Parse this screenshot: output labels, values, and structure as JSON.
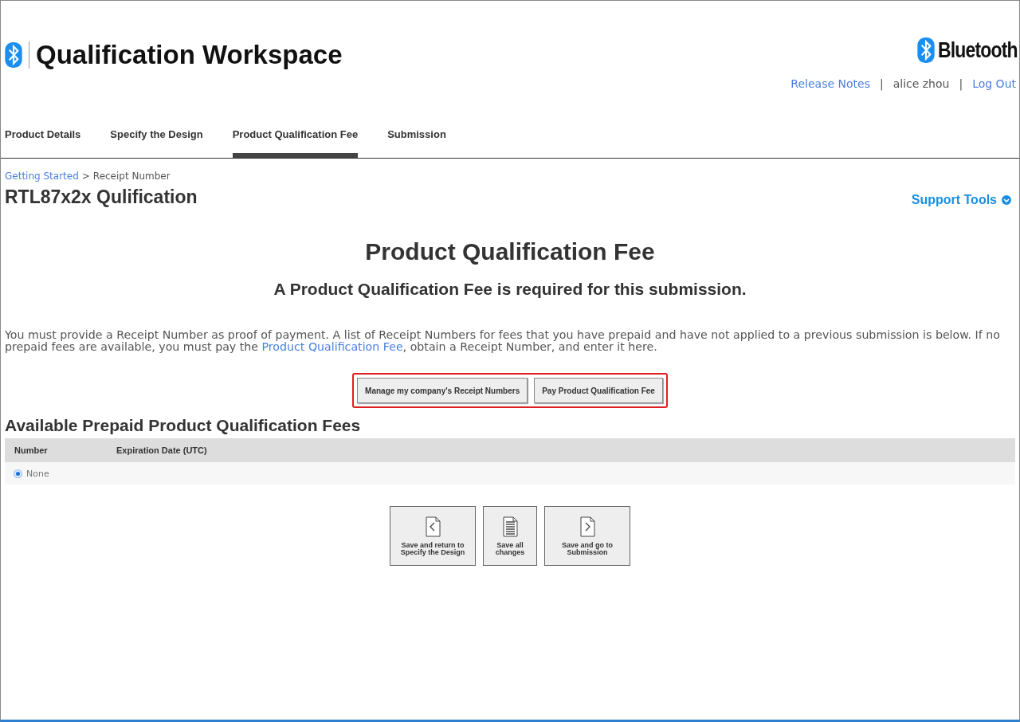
{
  "header": {
    "title": "Qualification Workspace",
    "brand": "Bluetooth",
    "links": [
      {
        "kind": "link",
        "label": "Release Notes"
      },
      {
        "kind": "separator",
        "label": "|"
      },
      {
        "kind": "text",
        "label": "alice zhou"
      },
      {
        "kind": "separator",
        "label": "|"
      },
      {
        "kind": "link",
        "label": "Log Out"
      }
    ]
  },
  "tabs": [
    {
      "label": "Product Details",
      "selected": false
    },
    {
      "label": "Specify the Design",
      "selected": false
    },
    {
      "label": "Product Qualification Fee",
      "selected": true
    },
    {
      "label": "Submission",
      "selected": false
    }
  ],
  "breadcrumb": {
    "link": "Getting Started",
    "separator": ">",
    "current": "Receipt Number"
  },
  "page_title": "RTL87x2x Qulification",
  "support_tools": "Support Tools",
  "heading": "Product Qualification Fee",
  "subheading": "A Product Qualification Fee is required for this submission.",
  "intro": {
    "before": "You must provide a Receipt Number as proof of payment. A list of Receipt Numbers for fees that you have prepaid and have not applied to a previous submission is below. If no prepaid fees are available, you must pay the ",
    "link": "Product Qualification Fee",
    "after": ", obtain a Receipt Number, and enter it here."
  },
  "action_buttons": [
    "Manage my company's Receipt Numbers",
    "Pay Product Qualification Fee"
  ],
  "section_title": "Available Prepaid Product Qualification Fees",
  "table": {
    "columns": [
      "Number",
      "Expiration Date (UTC)"
    ],
    "rows": [
      {
        "number": "None",
        "selected": true
      }
    ]
  },
  "nav_buttons": [
    {
      "kind": "back",
      "label": "Save and return to Specify the Design"
    },
    {
      "kind": "save",
      "label": "Save all changes"
    },
    {
      "kind": "forward",
      "label": "Save and go to Submission"
    }
  ]
}
